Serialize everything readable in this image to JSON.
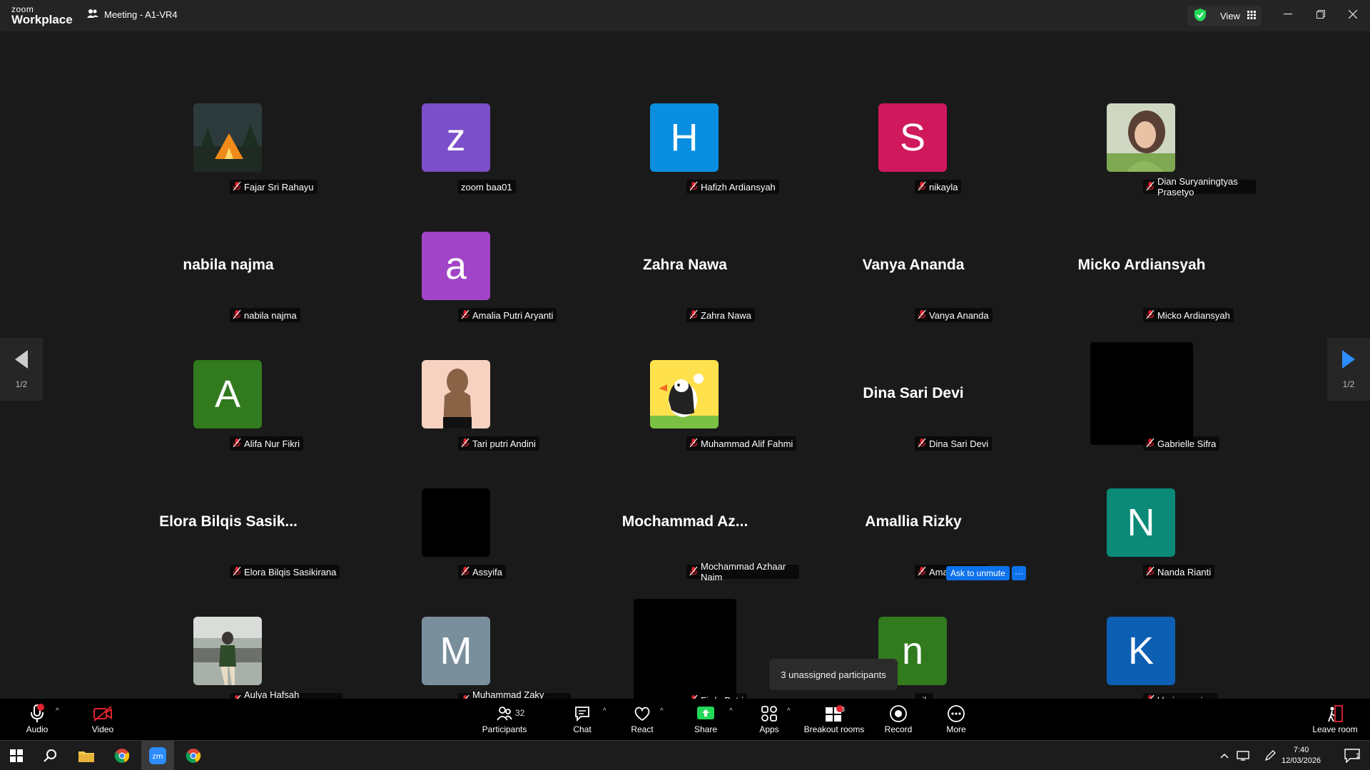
{
  "app": {
    "logo_line1": "zoom",
    "logo_line2": "Workplace",
    "meeting_title": "Meeting - A1-VR4",
    "view_label": "View"
  },
  "colors": {
    "accent": "#0e72ed",
    "share_green": "#23d959",
    "muted_red": "#e0232e",
    "badge_red": "#e0232e"
  },
  "tiles": [
    {
      "name": "Fajar Sri Rahayu",
      "kind": "photo",
      "photo": "tent",
      "muted": true
    },
    {
      "name": "zoom baa01",
      "kind": "initial",
      "initial": "z",
      "color": "#7b4fc9",
      "muted": false
    },
    {
      "name": "Hafizh Ardiansyah",
      "kind": "initial",
      "initial": "H",
      "color": "#0a8fe0",
      "muted": true
    },
    {
      "name": "nikayla",
      "kind": "initial",
      "initial": "S",
      "color": "#d0185d",
      "muted": true
    },
    {
      "name": "Dian Suryaningtyas Prasetyo",
      "kind": "photo",
      "photo": "portrait",
      "muted": true
    },
    {
      "name": "nabila najma",
      "kind": "text",
      "display": "nabila najma",
      "muted": true
    },
    {
      "name": "Amalia Putri Aryanti",
      "kind": "initial",
      "initial": "a",
      "color": "#a144c7",
      "muted": true
    },
    {
      "name": "Zahra Nawa",
      "kind": "text",
      "display": "Zahra Nawa",
      "muted": true
    },
    {
      "name": "Vanya Ananda",
      "kind": "text",
      "display": "Vanya Ananda",
      "muted": true
    },
    {
      "name": "Micko Ardiansyah",
      "kind": "text",
      "display": "Micko Ardiansyah",
      "muted": true
    },
    {
      "name": "Alifa Nur Fikri",
      "kind": "initial",
      "initial": "A",
      "color": "#317a1e",
      "muted": true
    },
    {
      "name": "Tari putri Andini",
      "kind": "photo",
      "photo": "silhouette",
      "muted": true
    },
    {
      "name": "Muhammad Alif Fahmi",
      "kind": "photo",
      "photo": "puffin",
      "muted": true
    },
    {
      "name": "Dina Sari Devi",
      "kind": "text",
      "display": "Dina Sari Devi",
      "muted": true
    },
    {
      "name": "Gabrielle Sifra",
      "kind": "bigblack",
      "muted": true
    },
    {
      "name": "Elora Bilqis Sasikirana",
      "kind": "text",
      "display": "Elora  Bilqis  Sasik...",
      "muted": true
    },
    {
      "name": "Assyifa",
      "kind": "black",
      "muted": true
    },
    {
      "name": "Mochammad Azhaar Naim",
      "kind": "text",
      "display": "Mochammad  Az...",
      "muted": true
    },
    {
      "name": "Amallia Rizky",
      "kind": "text",
      "display": "Amallia Rizky",
      "muted": true
    },
    {
      "name": "Nanda Rianti",
      "kind": "initial",
      "initial": "N",
      "color": "#0b8a78",
      "muted": true
    },
    {
      "name": "Aulya Hafsah Wulandari",
      "kind": "photo",
      "photo": "outdoor",
      "muted": true
    },
    {
      "name": "Muhammad Zaky Firmansyah",
      "kind": "initial",
      "initial": "M",
      "color": "#7a8f9c",
      "muted": true
    },
    {
      "name": "Firda Putri",
      "kind": "bigblack",
      "muted": true
    },
    {
      "name": "sih",
      "kind": "initial",
      "initial": "n",
      "color": "#317a1e",
      "muted": false
    },
    {
      "name": "khairun najwa",
      "kind": "initial",
      "initial": "K",
      "color": "#0d5fb3",
      "muted": true
    }
  ],
  "nav": {
    "page_left": "1/2",
    "page_right": "1/2"
  },
  "ask_unmute": "Ask to unmute",
  "more_dots": "···",
  "tooltip": "3 unassigned participants",
  "toolbar": {
    "audio": "Audio",
    "video": "Video",
    "participants": "Participants",
    "participants_count": "32",
    "chat": "Chat",
    "react": "React",
    "share": "Share",
    "apps": "Apps",
    "breakout": "Breakout rooms",
    "breakout_badge": "3",
    "record": "Record",
    "more": "More",
    "leave": "Leave room"
  },
  "taskbar": {
    "time": "7:40",
    "date": "12/03/2026",
    "notification_count": "1"
  }
}
